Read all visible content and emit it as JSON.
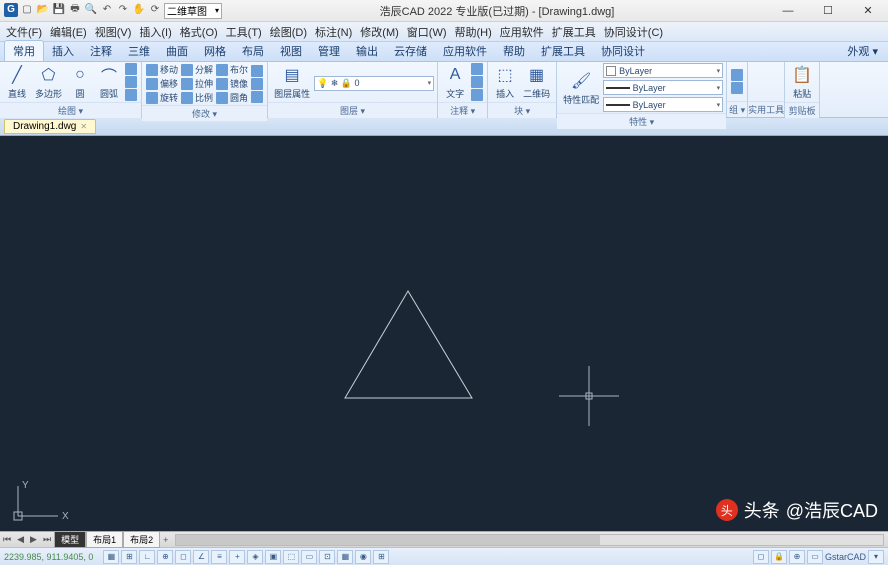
{
  "title": "浩辰CAD 2022 专业版(已过期) - [Drawing1.dwg]",
  "qat_combo": "二维草图",
  "menu": [
    "文件(F)",
    "编辑(E)",
    "视图(V)",
    "插入(I)",
    "格式(O)",
    "工具(T)",
    "绘图(D)",
    "标注(N)",
    "修改(M)",
    "窗口(W)",
    "帮助(H)",
    "应用软件",
    "扩展工具",
    "协同设计(C)"
  ],
  "ribbon_tabs": [
    "常用",
    "插入",
    "注释",
    "三维",
    "曲面",
    "网格",
    "布局",
    "视图",
    "管理",
    "输出",
    "云存储",
    "应用软件",
    "帮助",
    "扩展工具",
    "协同设计"
  ],
  "ribbon_right": "外观 ▾",
  "panels": {
    "draw": {
      "label": "绘图 ▾",
      "line": "直线",
      "poly": "多边形",
      "circle": "圆",
      "arc": "圆弧"
    },
    "modify": {
      "label": "修改 ▾",
      "move": "移动",
      "decompose": "分解",
      "bool": "布尔",
      "offset": "偏移",
      "stretch": "拉伸",
      "mirror": "镜像",
      "rotate": "旋转",
      "scale": "比例",
      "fillet": "圆角"
    },
    "layer": {
      "label": "图层 ▾",
      "btn": "图层属性"
    },
    "annotate": {
      "label": "注释 ▾",
      "text": "文字"
    },
    "block": {
      "label": "块 ▾",
      "insert": "插入"
    },
    "qr": {
      "label": "二维码"
    },
    "props": {
      "label": "特性 ▾",
      "match": "特性匹配",
      "bylayer": "ByLayer"
    },
    "group": {
      "label": "组 ▾"
    },
    "utils": {
      "label": "实用工具"
    },
    "clip": {
      "label": "剪贴板",
      "paste": "粘贴"
    }
  },
  "doc_tab": "Drawing1.dwg",
  "layout": {
    "model": "模型",
    "l1": "布局1",
    "l2": "布局2"
  },
  "status": {
    "coords": "2239.985, 911.9405, 0",
    "gstar": "GstarCAD"
  },
  "watermark": {
    "prefix": "头条",
    "handle": "@浩辰CAD"
  },
  "axes": {
    "x": "X",
    "y": "Y"
  }
}
